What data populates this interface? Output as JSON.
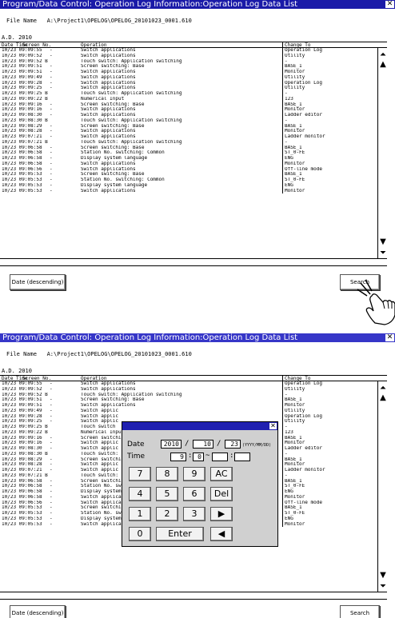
{
  "title": "Program/Data Control: Operation Log Information:Operation Log Data List",
  "close_glyph": "✕",
  "file_label": "File Name",
  "file_name": "A:\\Project1\\OPELOG\\OPELOG_20101023_0001.610",
  "year": "A.D. 2010",
  "columns": {
    "datetime": "Date  Time",
    "screen": "Screen No.",
    "operation": "Operation",
    "change": "Change To"
  },
  "rows": [
    {
      "time": "10/23 09:09:55",
      "screen": "-",
      "op": "Switch applications",
      "change": "Operation Log"
    },
    {
      "time": "10/23 09:09:52",
      "screen": "-",
      "op": "Switch applications",
      "change": "Utility"
    },
    {
      "time": "10/23 09:09:52 B -1",
      "screen": "",
      "op": "Touch switch: Application switching",
      "change": "-"
    },
    {
      "time": "10/23 09:09:51",
      "screen": "-",
      "op": "Screen switching: Base",
      "change": "BASE_1"
    },
    {
      "time": "10/23 09:09:51",
      "screen": "-",
      "op": "Switch applications",
      "change": "Monitor"
    },
    {
      "time": "10/23 09:09:49",
      "screen": "-",
      "op": "Switch applications",
      "change": "Utility"
    },
    {
      "time": "10/23 09:09:28",
      "screen": "-",
      "op": "Switch applications",
      "change": "Operation Log"
    },
    {
      "time": "10/23 09:09:25",
      "screen": "-",
      "op": "Switch applications",
      "change": "Utility"
    },
    {
      "time": "10/23 09:09:25 B -1",
      "screen": "",
      "op": "Touch switch: Application switching",
      "change": "-"
    },
    {
      "time": "10/23 09:09:22 B -1",
      "screen": "",
      "op": "Numerical Input",
      "change": "123"
    },
    {
      "time": "10/23 09:09:16",
      "screen": "-",
      "op": "Screen switching: Base",
      "change": "BASE_1"
    },
    {
      "time": "10/23 09:09:16",
      "screen": "-",
      "op": "Switch applications",
      "change": "Monitor"
    },
    {
      "time": "10/23 09:08:30",
      "screen": "-",
      "op": "Switch applications",
      "change": "Ladder editor"
    },
    {
      "time": "10/23 09:08:30 B -1",
      "screen": "",
      "op": "Touch switch: Application switching",
      "change": "-"
    },
    {
      "time": "10/23 09:08:29",
      "screen": "-",
      "op": "Screen switching: Base",
      "change": "BASE_1"
    },
    {
      "time": "10/23 09:08:28",
      "screen": "-",
      "op": "Switch applications",
      "change": "Monitor"
    },
    {
      "time": "10/23 09:07:21",
      "screen": "-",
      "op": "Switch applications",
      "change": "Ladder monitor"
    },
    {
      "time": "10/23 09:07:21 B -1",
      "screen": "",
      "op": "Touch switch: Application switching",
      "change": "-"
    },
    {
      "time": "10/23 09:06:58",
      "screen": "-",
      "op": "Screen switching: Base",
      "change": "BASE_1"
    },
    {
      "time": "10/23 09:06:58",
      "screen": "-",
      "op": "Station No. switching: Common",
      "change": "ST_0-FE"
    },
    {
      "time": "10/23 09:06:58",
      "screen": "-",
      "op": "Display system language",
      "change": "ENG"
    },
    {
      "time": "10/23 09:06:58",
      "screen": "-",
      "op": "Switch applications",
      "change": "Monitor"
    },
    {
      "time": "10/23 09:06:56",
      "screen": "-",
      "op": "Switch applications",
      "change": "Off-line mode"
    },
    {
      "time": "10/23 09:05:53",
      "screen": "-",
      "op": "Screen switching: Base",
      "change": "BASE_1"
    },
    {
      "time": "10/23 09:05:53",
      "screen": "-",
      "op": "Station No. switching: Common",
      "change": "ST_0-FE"
    },
    {
      "time": "10/23 09:05:53",
      "screen": "-",
      "op": "Display system language",
      "change": "ENG"
    },
    {
      "time": "10/23 09:05:53",
      "screen": "-",
      "op": "Switch applications",
      "change": "Monitor"
    }
  ],
  "rows_b": [
    {
      "time": "10/23 09:09:55",
      "screen": "-",
      "op": "Switch applications",
      "change": "Operation Log"
    },
    {
      "time": "10/23 09:09:52",
      "screen": "-",
      "op": "Switch applications",
      "change": "Utility"
    },
    {
      "time": "10/23 09:09:52 B -1",
      "screen": "",
      "op": "Touch switch: Application switching",
      "change": "-"
    },
    {
      "time": "10/23 09:09:51",
      "screen": "-",
      "op": "Screen switching: Base",
      "change": "BASE_1"
    },
    {
      "time": "10/23 09:09:51",
      "screen": "-",
      "op": "Switch applications",
      "change": "Monitor"
    },
    {
      "time": "10/23 09:09:49",
      "screen": "-",
      "op": "Switch applic",
      "change": "Utility"
    },
    {
      "time": "10/23 09:09:28",
      "screen": "-",
      "op": "Switch applic",
      "change": "Operation Log"
    },
    {
      "time": "10/23 09:09:25",
      "screen": "-",
      "op": "Switch applic",
      "change": "Utility"
    },
    {
      "time": "10/23 09:09:25 B -1",
      "screen": "",
      "op": "Touch switch",
      "change": "-"
    },
    {
      "time": "10/23 09:09:22 B -1",
      "screen": "",
      "op": "Numerical Inpu",
      "change": "123"
    },
    {
      "time": "10/23 09:09:16",
      "screen": "-",
      "op": "Screen switchi",
      "change": "BASE_1"
    },
    {
      "time": "10/23 09:09:16",
      "screen": "-",
      "op": "Switch applic",
      "change": "Monitor"
    },
    {
      "time": "10/23 09:08:30",
      "screen": "-",
      "op": "Switch applic",
      "change": "Ladder editor"
    },
    {
      "time": "10/23 09:08:30 B -1",
      "screen": "",
      "op": "Touch switch:",
      "change": "-"
    },
    {
      "time": "10/23 09:08:29",
      "screen": "-",
      "op": "Screen switchi",
      "change": "BASE_1"
    },
    {
      "time": "10/23 09:08:28",
      "screen": "-",
      "op": "Switch applic",
      "change": "Monitor"
    },
    {
      "time": "10/23 09:07:21",
      "screen": "-",
      "op": "Switch applic",
      "change": "Ladder monitor"
    },
    {
      "time": "10/23 09:07:21 B -1",
      "screen": "",
      "op": "Touch switch:",
      "change": "-"
    },
    {
      "time": "10/23 09:06:58",
      "screen": "-",
      "op": "Screen switchi",
      "change": "BASE_1"
    },
    {
      "time": "10/23 09:06:58",
      "screen": "-",
      "op": "Station No. sw",
      "change": "ST_0-FE"
    },
    {
      "time": "10/23 09:06:58",
      "screen": "-",
      "op": "Display system language",
      "change": "ENG"
    },
    {
      "time": "10/23 09:06:58",
      "screen": "-",
      "op": "Switch applications",
      "change": "Monitor"
    },
    {
      "time": "10/23 09:06:56",
      "screen": "-",
      "op": "Switch applications",
      "change": "Off-line mode"
    },
    {
      "time": "10/23 09:05:53",
      "screen": "-",
      "op": "Screen switching: Base",
      "change": "BASE_1"
    },
    {
      "time": "10/23 09:05:53",
      "screen": "-",
      "op": "Station No. switching: Common",
      "change": "ST_0-FE"
    },
    {
      "time": "10/23 09:05:53",
      "screen": "-",
      "op": "Display system language",
      "change": "ENG"
    },
    {
      "time": "10/23 09:05:53",
      "screen": "-",
      "op": "Switch applications",
      "change": "Monitor"
    }
  ],
  "scroll_up_glyph": "▲",
  "scroll_top_glyph": "⏶",
  "scroll_down_glyph": "▼",
  "scroll_bottom_glyph": "⏷",
  "buttons": {
    "date": "Date (descending)",
    "search": "Search"
  },
  "dialog": {
    "close_glyph": "✕",
    "date_label": "Date",
    "time_label": "Time",
    "year": "2010",
    "month": "10",
    "day": "23",
    "date_sep": "/",
    "date_format": "(YYYY/MM/DD)",
    "hour": "9",
    "minute": "0",
    "second": "",
    "time_sep": ":",
    "range_sep": "~",
    "end_hour": "",
    "end_minute": "",
    "keys": [
      "7",
      "8",
      "9",
      "AC",
      "4",
      "5",
      "6",
      "Del",
      "1",
      "2",
      "3",
      "▶",
      "0",
      "Enter",
      "◀"
    ]
  },
  "colors": {
    "titlebar": "#1a1aa8",
    "dialog_bg": "#d0d0d0"
  }
}
